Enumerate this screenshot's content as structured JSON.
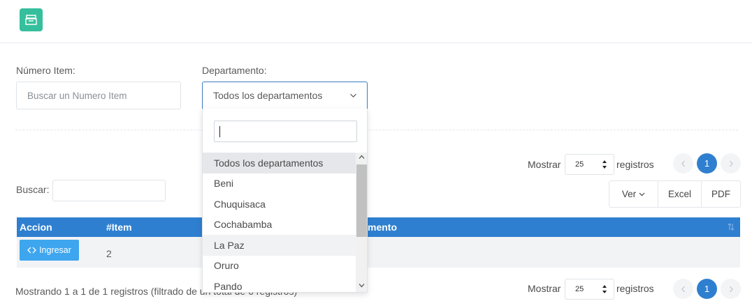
{
  "filters": {
    "numero_item_label": "Número Item:",
    "numero_item_placeholder": "Buscar un Numero Item",
    "departamento_label": "Departamento:",
    "departamento_value": "Todos los departamentos"
  },
  "dropdown": {
    "search_value": "",
    "options": [
      "Todos los departamentos",
      "Beni",
      "Chuquisaca",
      "Cochabamba",
      "La Paz",
      "Oruro",
      "Pando"
    ],
    "selected": "Todos los departamentos",
    "highlighted": "La Paz"
  },
  "table_controls": {
    "buscar_label": "Buscar:",
    "mostrar_label": "Mostrar",
    "page_length": "25",
    "registros_label": "registros",
    "current_page": "1",
    "buttons": [
      "Ver",
      "Excel",
      "PDF"
    ]
  },
  "table": {
    "columns": [
      "Accion",
      "#Item",
      "mento"
    ],
    "rows": [
      {
        "action": "Ingresar",
        "item": "2"
      }
    ]
  },
  "footer": {
    "info": "Mostrando 1 a 1 de 1 registros (filtrado de un total de 6 registros)"
  },
  "colors": {
    "brand": "#36bf9c",
    "primary": "#2f7fd0",
    "button": "#3ea6ef"
  }
}
